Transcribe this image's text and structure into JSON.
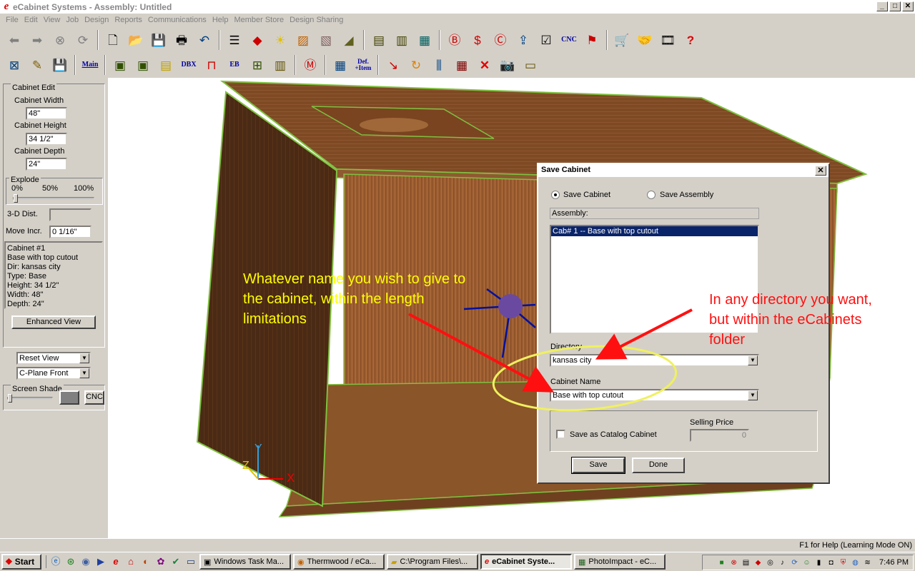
{
  "window": {
    "title": "eCabinet Systems - Assembly: Untitled",
    "min": "_",
    "max": "□",
    "close": "✕"
  },
  "menu": [
    "File",
    "Edit",
    "View",
    "Job",
    "Design",
    "Reports",
    "Communications",
    "Help",
    "Member Store",
    "Design Sharing"
  ],
  "toolbar": {
    "cnc_label": "CNC",
    "main_label": "Main",
    "dbx_label": "DBX",
    "eb_label": "EB",
    "def_item_label": "Def.\n+Item",
    "help_glyph": "?"
  },
  "left_panel": {
    "cabinet_edit_title": "Cabinet Edit",
    "width_label": "Cabinet Width",
    "width_value": "48\"",
    "height_label": "Cabinet Height",
    "height_value": "34 1/2\"",
    "depth_label": "Cabinet Depth",
    "depth_value": "24\"",
    "explode_title": "Explode",
    "explode_ticks": [
      "0%",
      "50%",
      "100%"
    ],
    "dist_label": "3-D Dist.",
    "dist_value": "",
    "move_label": "Move Incr.",
    "move_value": "0 1/16\"",
    "info": [
      "Cabinet #1",
      "Base with top cutout",
      "Dir: kansas city",
      "Type: Base",
      "Height: 34 1/2\"",
      "Width: 48\"",
      "Depth: 24\""
    ],
    "enhanced_view": "Enhanced View",
    "reset_view": "Reset View",
    "cplane": "C-Plane Front",
    "screen_shade": "Screen Shade",
    "cnc": "CNC"
  },
  "dialog": {
    "title": "Save Cabinet",
    "close": "✕",
    "save_cabinet": "Save Cabinet",
    "save_assembly": "Save Assembly",
    "assembly_label": "Assembly:",
    "list_items": [
      "Cab# 1 -- Base with top cutout"
    ],
    "directory_label": "Directory",
    "directory_value": "kansas city",
    "cabinet_name_label": "Cabinet Name",
    "cabinet_name_value": "Base with top cutout",
    "catalog_label": "Save as Catalog Cabinet",
    "selling_price_label": "Selling Price",
    "selling_price_value": "0",
    "save_btn": "Save",
    "done_btn": "Done"
  },
  "annotations": {
    "yellow_text": "Whatever name you wish to give to the cabinet, within the length limitations",
    "red_text": "In any directory you want, but within the eCabinets folder"
  },
  "axes": {
    "x": "X",
    "y": "Y",
    "z": "Z"
  },
  "status": {
    "help": "F1 for Help (Learning Mode ON)"
  },
  "taskbar": {
    "start": "Start",
    "tasks": [
      "Windows Task Ma...",
      "Thermwood / eCa...",
      "C:\\Program Files\\...",
      "eCabinet Syste...",
      "PhotoImpact - eC..."
    ],
    "active_index": 3,
    "clock": "7:46 PM"
  },
  "colors": {
    "accent": "#0a246a",
    "wood_dark": "#4a2a14",
    "wood_mid": "#8b5a30",
    "wood_light": "#a8703c",
    "edge": "#7fc040",
    "annot_yellow": "#ffff00",
    "annot_red": "#ff1010"
  }
}
